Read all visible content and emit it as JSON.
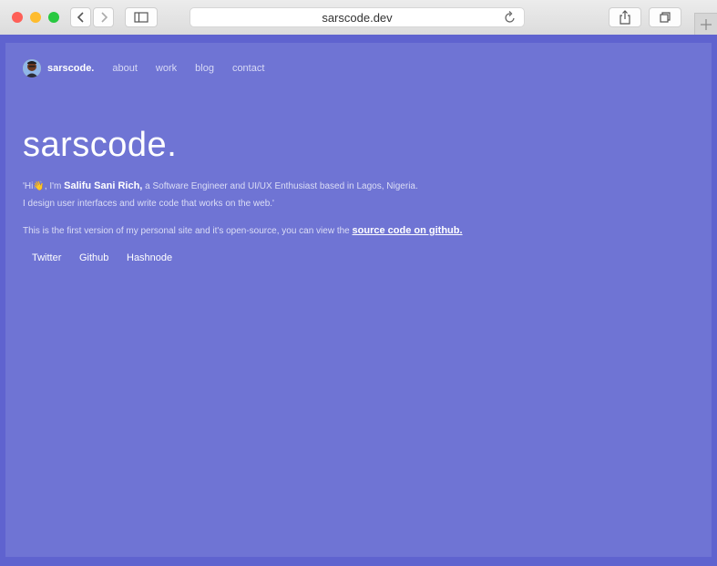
{
  "browser": {
    "url": "sarscode.dev",
    "colors": {
      "close": "#fe5f57",
      "minimize": "#febc2e",
      "zoom": "#28c840"
    },
    "icons": [
      "back-icon",
      "forward-icon",
      "sidebar-icon",
      "reload-icon",
      "share-icon",
      "tabs-icon",
      "plus-icon"
    ]
  },
  "site": {
    "accent_color": "#6f74d4",
    "nav": {
      "brand": "sarscode.",
      "links": [
        "about",
        "work",
        "blog",
        "contact"
      ]
    },
    "hero_title": "sarscode.",
    "intro": {
      "line1_prefix": "'Hi",
      "wave_emoji": "👋",
      "line1_mid": ", I'm ",
      "name": "Salifu Sani Rich,",
      "line1_suffix": " a Software Engineer and UI/UX Enthusiast based in Lagos, Nigeria.",
      "line2": "I design user interfaces and write code that works on the web.'"
    },
    "source": {
      "text": "This is the first version of my personal site and it's open-source, you can view the ",
      "link_text": "source code on github."
    },
    "social": [
      "Twitter",
      "Github",
      "Hashnode"
    ]
  }
}
